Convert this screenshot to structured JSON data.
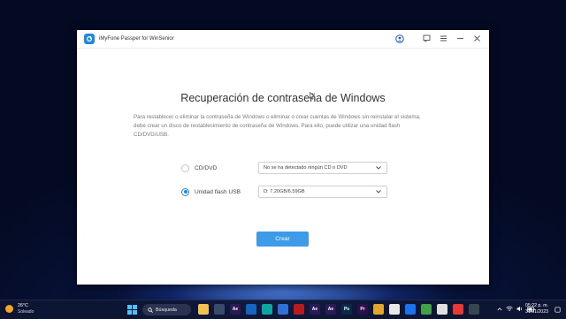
{
  "window": {
    "app_title": "iMyFone Passper for WinSenior"
  },
  "main": {
    "heading": "Recuperación de contraseña de Windows",
    "description": "Para restablecer o eliminar la contraseña de Windows o eliminar o crear cuentas de Windows sin reinstalar el sistema, debe crear un disco de restablecimiento de contraseña de Windows. Para ello, puede utilizar una unidad flash CD/DVD/USB.",
    "options": [
      {
        "label": "CD/DVD",
        "selected": false,
        "select_value": "No se ha detectado ningún CD o DVD"
      },
      {
        "label": "Unidad flash USB",
        "selected": true,
        "select_value": "D: 7.20GB/6.59GB"
      }
    ],
    "create_label": "Crear"
  },
  "taskbar": {
    "weather_temp": "26°C",
    "weather_condition": "Soleado",
    "search_label": "Búsqueda",
    "apps": [
      {
        "icon": "file-explorer-icon",
        "text": "",
        "color": "#f2c14e"
      },
      {
        "icon": "camera-icon",
        "text": "",
        "color": "#3a4a6a"
      },
      {
        "icon": "after-effects-icon",
        "text": "Ae",
        "color": "#2b1a55"
      },
      {
        "icon": "media-player-icon",
        "text": "",
        "color": "#1565c0"
      },
      {
        "icon": "edge-icon",
        "text": "",
        "color": "#0ea5a0"
      },
      {
        "icon": "store-icon",
        "text": "",
        "color": "#2f6fd6"
      },
      {
        "icon": "davinci-icon",
        "text": "",
        "color": "#b71c1c"
      },
      {
        "icon": "after-effects-icon",
        "text": "Ae",
        "color": "#2b1a55"
      },
      {
        "icon": "after-effects-icon",
        "text": "Ae",
        "color": "#2b1a55"
      },
      {
        "icon": "photoshop-icon",
        "text": "Ps",
        "color": "#0b2a4a"
      },
      {
        "icon": "premiere-icon",
        "text": "Pr",
        "color": "#2a0f4a"
      },
      {
        "icon": "folder-icon",
        "text": "",
        "color": "#e3a72f"
      },
      {
        "icon": "chrome-icon",
        "text": "",
        "color": "#e8e8e8"
      },
      {
        "icon": "edge-icon",
        "text": "",
        "color": "#1a73e8"
      },
      {
        "icon": "notes-icon",
        "text": "",
        "color": "#43a047"
      },
      {
        "icon": "illustrator-icon",
        "text": "",
        "color": "#e0e0e0"
      },
      {
        "icon": "app-red-icon",
        "text": "",
        "color": "#e53935"
      },
      {
        "icon": "app-dark-icon",
        "text": "",
        "color": "#37474f"
      }
    ],
    "clock_time": "05:22 p. m.",
    "clock_date": "31/01/2023"
  }
}
